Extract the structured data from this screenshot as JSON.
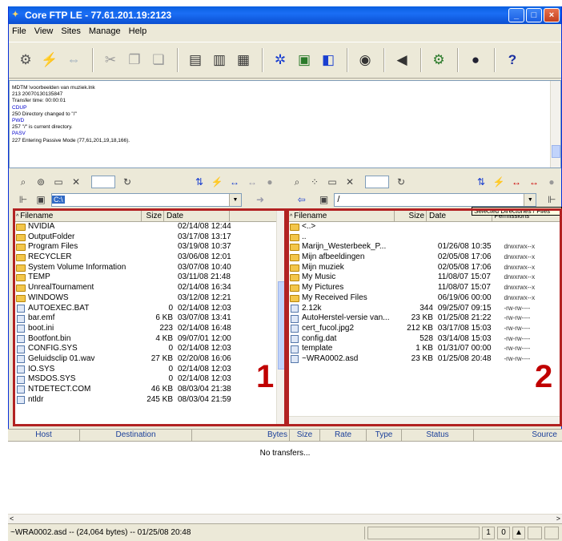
{
  "window": {
    "title": "Core FTP LE - 77.61.201.19:2123",
    "app_icon": "core-ftp-icon",
    "minimize": "_",
    "maximize": "□",
    "close": "×"
  },
  "menu": [
    "File",
    "View",
    "Sites",
    "Manage",
    "Help"
  ],
  "log_lines": [
    {
      "kind": "resp",
      "text": "MDTM \\voorbeelden van muziek.lnk"
    },
    {
      "kind": "resp",
      "text": "213 20070130135847"
    },
    {
      "kind": "resp",
      "text": "Transfer time: 00:00:01"
    },
    {
      "kind": "cmd",
      "text": "CDUP"
    },
    {
      "kind": "resp",
      "text": "250 Directory changed to \"/\""
    },
    {
      "kind": "cmd",
      "text": "PWD"
    },
    {
      "kind": "resp",
      "text": "257 \"/\" is current directory."
    },
    {
      "kind": "cmd",
      "text": "PASV"
    },
    {
      "kind": "resp",
      "text": "227 Entering Passive Mode (77,61,201,19,18,166)."
    }
  ],
  "left_panel": {
    "path": "C:\\",
    "headers": {
      "name": "Filename",
      "size": "Size",
      "date": "Date"
    },
    "files": [
      {
        "type": "folder",
        "name": "NVIDIA",
        "size": "",
        "date": "02/14/08 12:44"
      },
      {
        "type": "folder",
        "name": "OutputFolder",
        "size": "",
        "date": "03/17/08 13:17"
      },
      {
        "type": "folder",
        "name": "Program Files",
        "size": "",
        "date": "03/19/08 10:37"
      },
      {
        "type": "folder",
        "name": "RECYCLER",
        "size": "",
        "date": "03/06/08 12:01"
      },
      {
        "type": "folder",
        "name": "System Volume Information",
        "size": "",
        "date": "03/07/08 10:40"
      },
      {
        "type": "folder",
        "name": "TEMP",
        "size": "",
        "date": "03/11/08 21:48"
      },
      {
        "type": "folder",
        "name": "UnrealTournament",
        "size": "",
        "date": "02/14/08 16:34"
      },
      {
        "type": "folder",
        "name": "WINDOWS",
        "size": "",
        "date": "03/12/08 12:21"
      },
      {
        "type": "file",
        "name": "AUTOEXEC.BAT",
        "size": "0",
        "date": "02/14/08 12:03"
      },
      {
        "type": "file",
        "name": "bar.emf",
        "size": "6 KB",
        "date": "03/07/08 13:41"
      },
      {
        "type": "file",
        "name": "boot.ini",
        "size": "223",
        "date": "02/14/08 16:48"
      },
      {
        "type": "file",
        "name": "Bootfont.bin",
        "size": "4 KB",
        "date": "09/07/01 12:00"
      },
      {
        "type": "file",
        "name": "CONFIG.SYS",
        "size": "0",
        "date": "02/14/08 12:03"
      },
      {
        "type": "file",
        "name": "Geluidsclip 01.wav",
        "size": "27 KB",
        "date": "02/20/08 16:06"
      },
      {
        "type": "file",
        "name": "IO.SYS",
        "size": "0",
        "date": "02/14/08 12:03"
      },
      {
        "type": "file",
        "name": "MSDOS.SYS",
        "size": "0",
        "date": "02/14/08 12:03"
      },
      {
        "type": "file",
        "name": "NTDETECT.COM",
        "size": "46 KB",
        "date": "08/03/04 21:38"
      },
      {
        "type": "file",
        "name": "ntldr",
        "size": "245 KB",
        "date": "08/03/04 21:59"
      }
    ]
  },
  "right_panel": {
    "path": "/",
    "headers": {
      "name": "Filename",
      "size": "Size",
      "date": "Date",
      "perm": "Permissions"
    },
    "tooltip": "Selected Directories / Files",
    "files": [
      {
        "type": "folder",
        "name": "<..>",
        "size": "",
        "date": "",
        "perm": ""
      },
      {
        "type": "folder",
        "name": "..",
        "size": "",
        "date": "",
        "perm": ""
      },
      {
        "type": "folder",
        "name": "Marijn_Westerbeek_P...",
        "size": "",
        "date": "01/26/08 10:35",
        "perm": "drwxrwx--x"
      },
      {
        "type": "folder",
        "name": "Mijn afbeeldingen",
        "size": "",
        "date": "02/05/08 17:06",
        "perm": "drwxrwx--x"
      },
      {
        "type": "folder",
        "name": "Mijn muziek",
        "size": "",
        "date": "02/05/08 17:06",
        "perm": "drwxrwx--x"
      },
      {
        "type": "folder",
        "name": "My Music",
        "size": "",
        "date": "11/08/07 15:07",
        "perm": "drwxrwx--x"
      },
      {
        "type": "folder",
        "name": "My Pictures",
        "size": "",
        "date": "11/08/07 15:07",
        "perm": "drwxrwx--x"
      },
      {
        "type": "folder",
        "name": "My Received Files",
        "size": "",
        "date": "06/19/06 00:00",
        "perm": "drwxrwx--x"
      },
      {
        "type": "file",
        "name": "2.12k",
        "size": "344",
        "date": "09/25/07 09:15",
        "perm": "-rw-rw----"
      },
      {
        "type": "file",
        "name": "AutoHerstel-versie van...",
        "size": "23 KB",
        "date": "01/25/08 21:22",
        "perm": "-rw-rw----"
      },
      {
        "type": "file",
        "name": "cert_fucol.jpg2",
        "size": "212 KB",
        "date": "03/17/08 15:03",
        "perm": "-rw-rw----"
      },
      {
        "type": "file",
        "name": "config.dat",
        "size": "528",
        "date": "03/14/08 15:03",
        "perm": "-rw-rw----"
      },
      {
        "type": "file",
        "name": "template",
        "size": "1 KB",
        "date": "01/31/07 00:00",
        "perm": "-rw-rw----"
      },
      {
        "type": "file",
        "name": "~WRA0002.asd",
        "size": "23 KB",
        "date": "01/25/08 20:48",
        "perm": "-rw-rw----"
      }
    ]
  },
  "annotations": {
    "left_number": "1",
    "right_number": "2"
  },
  "transfer": {
    "columns": [
      "Host",
      "Destination",
      "Bytes",
      "Size",
      "Rate",
      "Type",
      "Status",
      "Source"
    ],
    "empty_message": "No transfers..."
  },
  "status": {
    "text": "~WRA0002.asd -- (24,064 bytes) -- 01/25/08 20:48",
    "count1": "1",
    "count2": "0"
  },
  "colors": {
    "accent": "#316ac5",
    "annotation_red": "#b22222",
    "log_command": "#0000cc"
  }
}
